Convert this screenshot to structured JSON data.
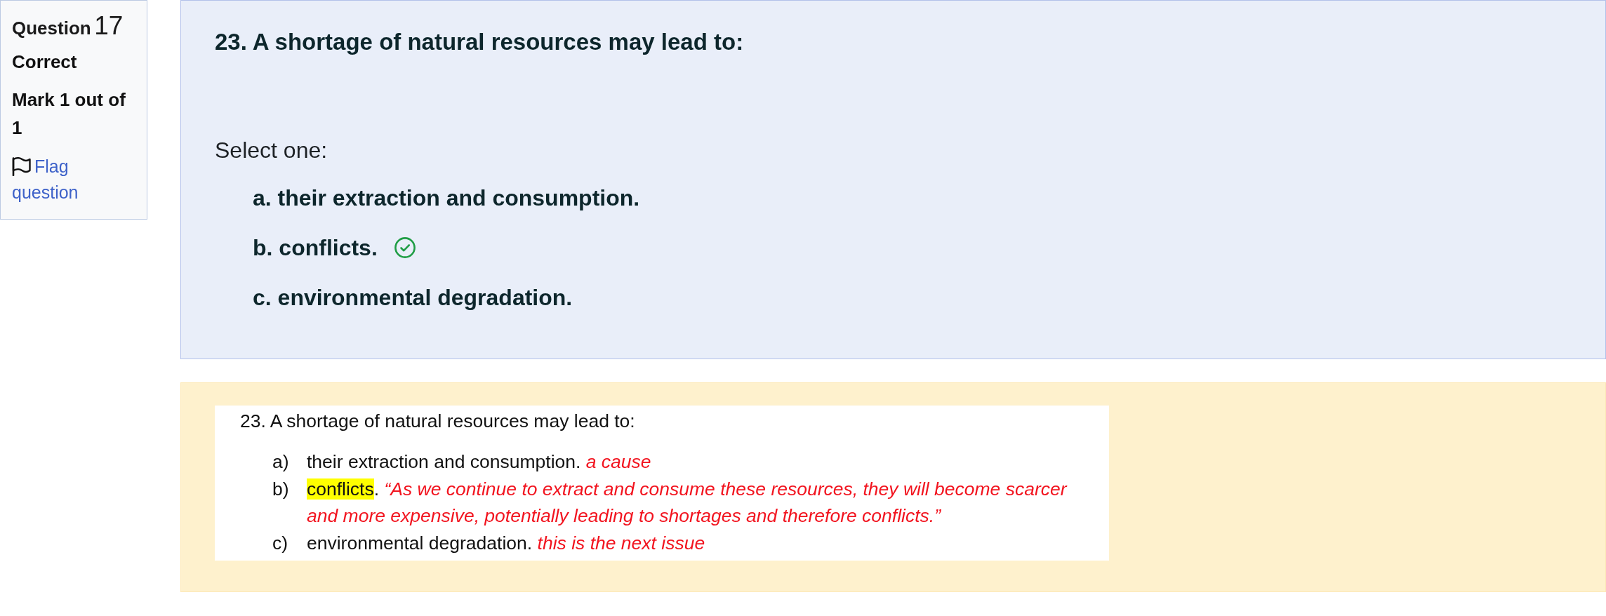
{
  "question_info": {
    "label": "Question",
    "number": "17",
    "state": "Correct",
    "mark": "Mark 1 out of 1",
    "flag_link": "Flag question",
    "flagged": false
  },
  "question": {
    "title": "23. A shortage of natural resources may lead to:",
    "prompt": "Select one:",
    "options": [
      {
        "label": "a.",
        "text": "their extraction and consumption.",
        "correct": false
      },
      {
        "label": "b.",
        "text": "conflicts.",
        "correct": true
      },
      {
        "label": "c.",
        "text": "environmental degradation.",
        "correct": false
      }
    ]
  },
  "feedback": {
    "document": {
      "title": "23. A shortage of natural resources may lead to:",
      "items": [
        {
          "marker": "a)",
          "answer": "their extraction and consumption.",
          "highlighted": false,
          "comment": "a cause"
        },
        {
          "marker": "b)",
          "answer": "conflicts",
          "suffix": ".",
          "highlighted": true,
          "comment": "“As we continue to extract and consume these resources, they will become scarcer and more expensive, potentially leading to shortages and therefore conflicts.”"
        },
        {
          "marker": "c)",
          "answer": "environmental degradation.",
          "highlighted": false,
          "comment": "this is the next issue"
        }
      ]
    }
  }
}
